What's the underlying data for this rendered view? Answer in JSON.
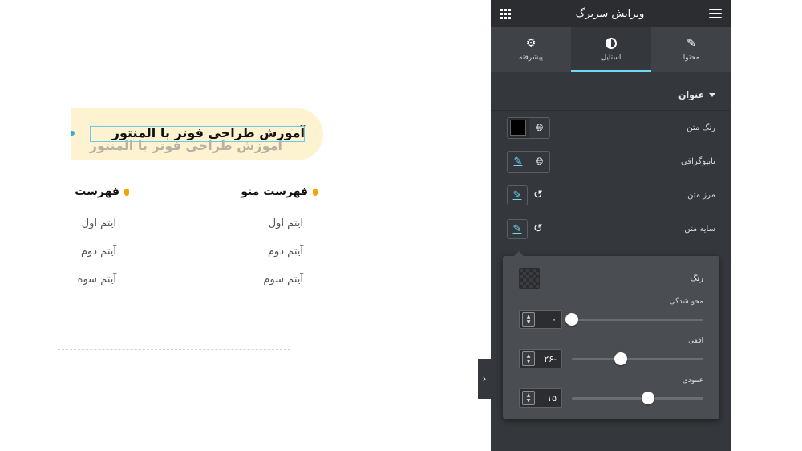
{
  "canvas": {
    "heading_text": "آموزش طراحی فوتر با المنتور",
    "heading_shadow_text": "آموزش طراحی فوتر با المنتور",
    "menus": [
      {
        "title": "فهرست منو",
        "items": [
          "آیتم اول",
          "آیتم دوم",
          "آیتم سوم"
        ]
      },
      {
        "title": "فهرست",
        "items": [
          "آیتم اول",
          "آیتم دوم",
          "آیتم سوه"
        ]
      }
    ],
    "collapse_arrow": "›"
  },
  "panel": {
    "title": "ویرایش سربرگ",
    "tabs": [
      {
        "label": "محتوا",
        "icon": "pencil-icon",
        "active": false
      },
      {
        "label": "استایل",
        "icon": "half-circle-icon",
        "active": true
      },
      {
        "label": "پیشرفته",
        "icon": "gear-icon",
        "active": false
      }
    ],
    "section_title": "عنوان",
    "rows": [
      {
        "label": "رنگ متن"
      },
      {
        "label": "تایپوگرافی"
      },
      {
        "label": "مرز متن"
      },
      {
        "label": "سایه متن"
      }
    ],
    "accent_color": "#71d7f7",
    "panel_bg": "#34373c"
  },
  "popover": {
    "color_label": "رنگ",
    "sliders": [
      {
        "label": "محو شدگی",
        "value": "۰",
        "fraction": 0.0
      },
      {
        "label": "افقی",
        "value": "-۲۶",
        "fraction": 0.37
      },
      {
        "label": "عمودی",
        "value": "۱۵",
        "fraction": 0.58
      }
    ]
  }
}
